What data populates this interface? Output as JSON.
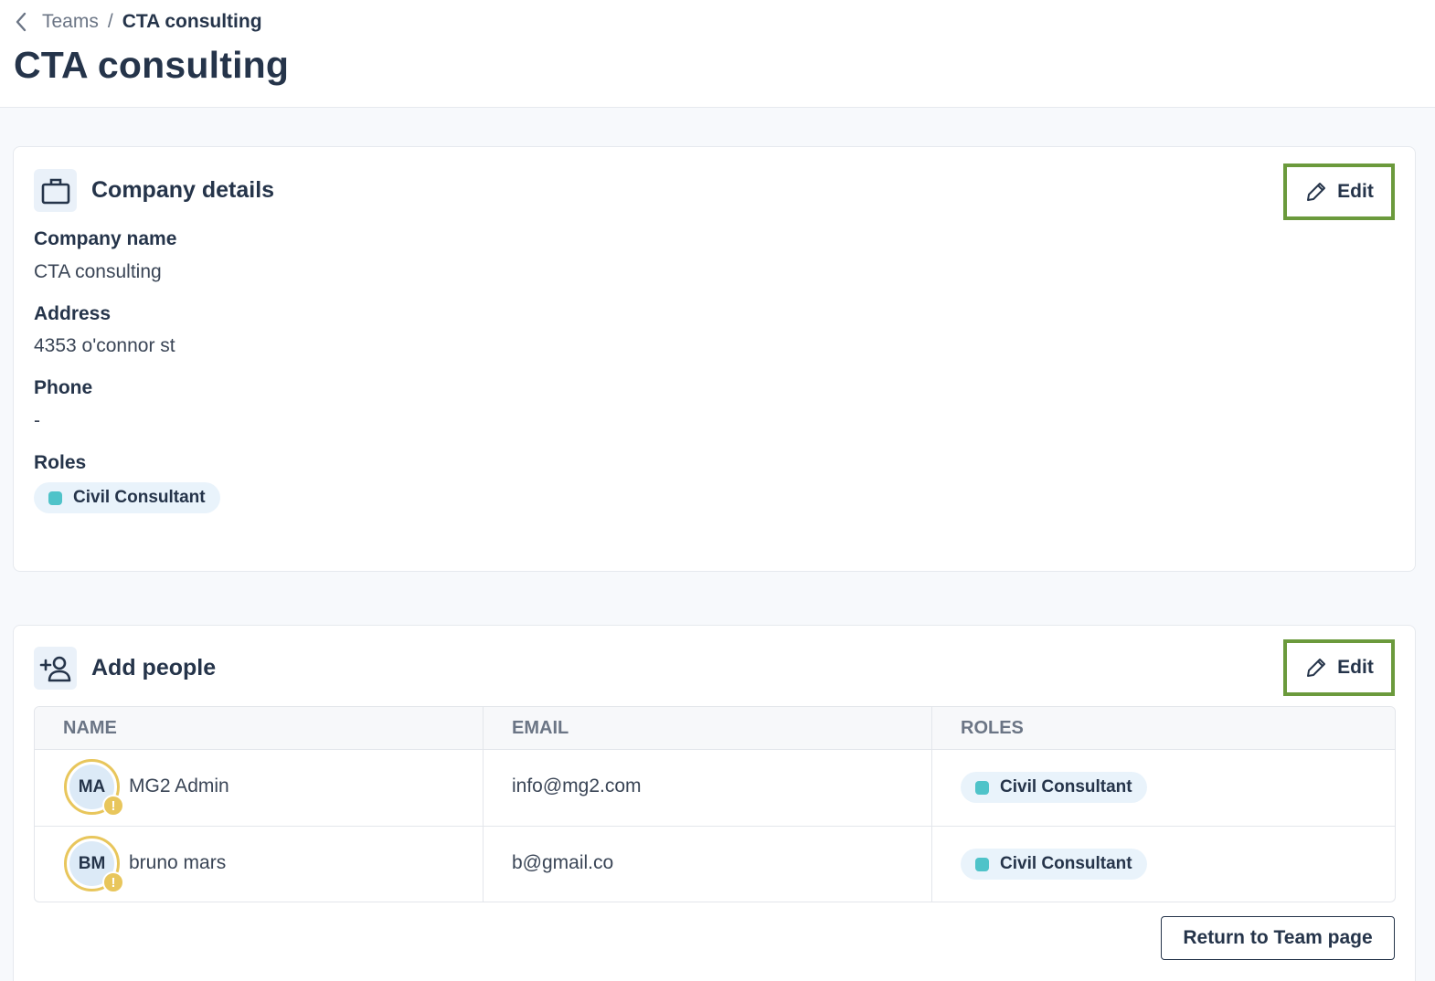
{
  "breadcrumb": {
    "parent": "Teams",
    "separator": "/",
    "current": "CTA consulting"
  },
  "page_title": "CTA consulting",
  "company_card": {
    "title": "Company details",
    "edit_label": "Edit",
    "fields": {
      "company_name_label": "Company name",
      "company_name_value": "CTA consulting",
      "address_label": "Address",
      "address_value": "4353 o'connor st",
      "phone_label": "Phone",
      "phone_value": "-",
      "roles_label": "Roles",
      "roles": [
        "Civil Consultant"
      ]
    }
  },
  "people_card": {
    "title": "Add people",
    "edit_label": "Edit",
    "columns": [
      "NAME",
      "EMAIL",
      "ROLES"
    ],
    "rows": [
      {
        "initials": "MA",
        "badge": "!",
        "name": "MG2 Admin",
        "email": "info@mg2.com",
        "role": "Civil Consultant"
      },
      {
        "initials": "BM",
        "badge": "!",
        "name": "bruno mars",
        "email": "b@gmail.co",
        "role": "Civil Consultant"
      }
    ],
    "return_label": "Return to Team page"
  },
  "colors": {
    "highlight_border": "#6b9a3c",
    "role_dot": "#4fc3c9",
    "avatar_warning": "#e8c65c",
    "text_primary": "#25344a"
  }
}
